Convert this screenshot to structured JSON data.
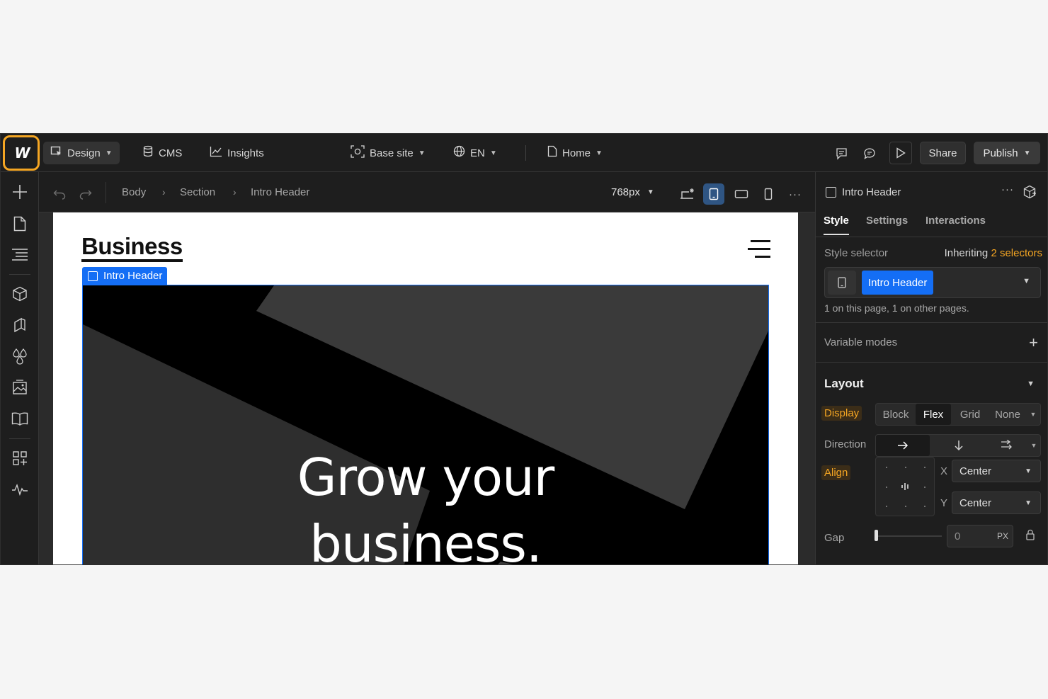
{
  "topbar": {
    "logo": "W",
    "design_label": "Design",
    "cms_label": "CMS",
    "insights_label": "Insights",
    "base_site_label": "Base site",
    "language_label": "EN",
    "page_label": "Home",
    "share_label": "Share",
    "publish_label": "Publish"
  },
  "subbar": {
    "breadcrumb": [
      "Body",
      "Section",
      "Intro Header"
    ],
    "width_value": "768px"
  },
  "canvas": {
    "brand": "Business",
    "selected_tag": "Intro Header",
    "hero_line1": "Grow your",
    "hero_line2": "business."
  },
  "panel": {
    "element_name": "Intro Header",
    "tabs": [
      "Style",
      "Settings",
      "Interactions"
    ],
    "style_selector_label": "Style selector",
    "inheriting_text": "Inheriting",
    "inheriting_count": "2 selectors",
    "selector_chip": "Intro Header",
    "selector_note": "1 on this page, 1 on other pages.",
    "variable_modes_label": "Variable modes",
    "layout_title": "Layout",
    "display_label": "Display",
    "display_options": [
      "Block",
      "Flex",
      "Grid",
      "None"
    ],
    "display_selected": "Flex",
    "direction_label": "Direction",
    "align_label": "Align",
    "x_label": "X",
    "x_value": "Center",
    "y_label": "Y",
    "y_value": "Center",
    "gap_label": "Gap",
    "gap_value": "0",
    "gap_unit": "PX"
  },
  "colors": {
    "accent_blue": "#146ef5",
    "highlight_orange": "#f5a623",
    "chrome_dark": "#1e1e1e"
  }
}
